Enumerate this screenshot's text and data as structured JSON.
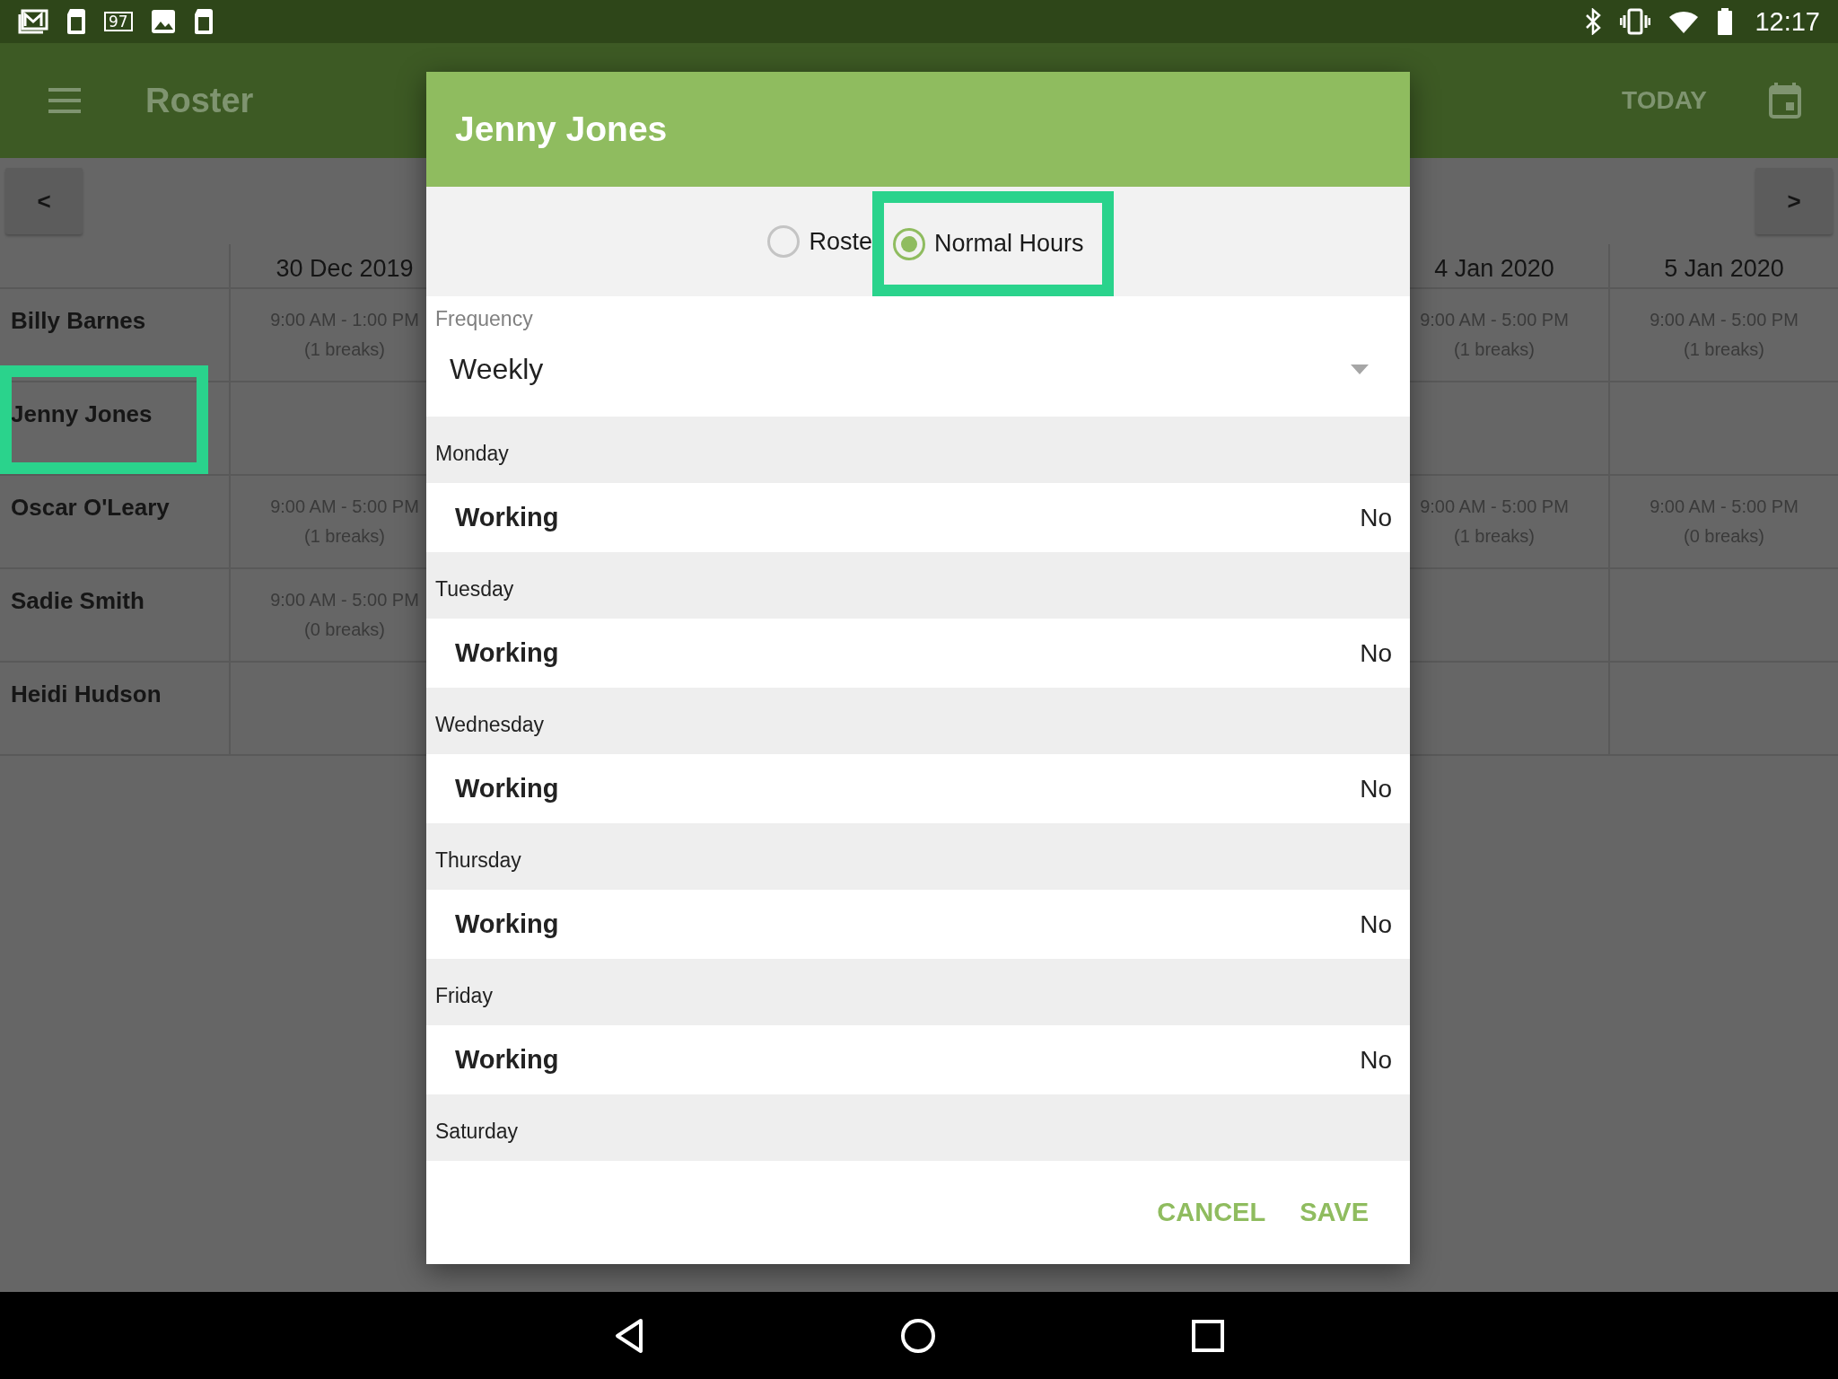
{
  "status_bar": {
    "battery_badge": "97",
    "time": "12:17"
  },
  "app_bar": {
    "title": "Roster",
    "today_button": "TODAY"
  },
  "week_nav": {
    "previous": "<",
    "next": ">"
  },
  "roster": {
    "columns": [
      {
        "date": "30 Dec 2019"
      },
      {
        "date": "4 Jan 2020"
      },
      {
        "date": "5 Jan 2020"
      }
    ],
    "rows": [
      {
        "name": "Billy Barnes",
        "highlighted": false,
        "shifts": [
          {
            "kind": "shift",
            "time": "9:00 AM - 1:00 PM",
            "breaks": "(1 breaks)"
          },
          {
            "kind": "shift",
            "time": "9:00 AM - 5:00 PM",
            "breaks": "(1 breaks)"
          },
          {
            "kind": "shift",
            "time": "9:00 AM - 5:00 PM",
            "breaks": "(1 breaks)"
          }
        ]
      },
      {
        "name": "Jenny Jones",
        "highlighted": true,
        "shifts": [
          {
            "kind": "empty"
          },
          {
            "kind": "empty"
          },
          {
            "kind": "empty"
          }
        ]
      },
      {
        "name": "Oscar O'Leary",
        "highlighted": false,
        "shifts": [
          {
            "kind": "shift",
            "time": "9:00 AM - 5:00 PM",
            "breaks": "(1 breaks)"
          },
          {
            "kind": "shift",
            "time": "9:00 AM - 5:00 PM",
            "breaks": "(1 breaks)"
          },
          {
            "kind": "shift",
            "time": "9:00 AM - 5:00 PM",
            "breaks": "(0 breaks)"
          }
        ]
      },
      {
        "name": "Sadie Smith",
        "highlighted": false,
        "shifts": [
          {
            "kind": "shift",
            "time": "9:00 AM - 5:00 PM",
            "breaks": "(0 breaks)"
          },
          {
            "kind": "empty"
          },
          {
            "kind": "empty"
          }
        ]
      },
      {
        "name": "Heidi Hudson",
        "highlighted": false,
        "shifts": [
          {
            "kind": "empty"
          },
          {
            "kind": "empty"
          },
          {
            "kind": "empty"
          }
        ]
      }
    ]
  },
  "dialog": {
    "title": "Jenny Jones",
    "options": [
      {
        "label": "Roste",
        "selected": false,
        "highlighted": false
      },
      {
        "label": "Normal Hours",
        "selected": true,
        "highlighted": true
      }
    ],
    "frequency": {
      "label": "Frequency",
      "value": "Weekly"
    },
    "days": [
      {
        "day": "Monday",
        "setting": "Working",
        "value": "No"
      },
      {
        "day": "Tuesday",
        "setting": "Working",
        "value": "No"
      },
      {
        "day": "Wednesday",
        "setting": "Working",
        "value": "No"
      },
      {
        "day": "Thursday",
        "setting": "Working",
        "value": "No"
      },
      {
        "day": "Friday",
        "setting": "Working",
        "value": "No"
      },
      {
        "day": "Saturday"
      }
    ],
    "buttons": [
      "CANCEL",
      "SAVE"
    ]
  }
}
